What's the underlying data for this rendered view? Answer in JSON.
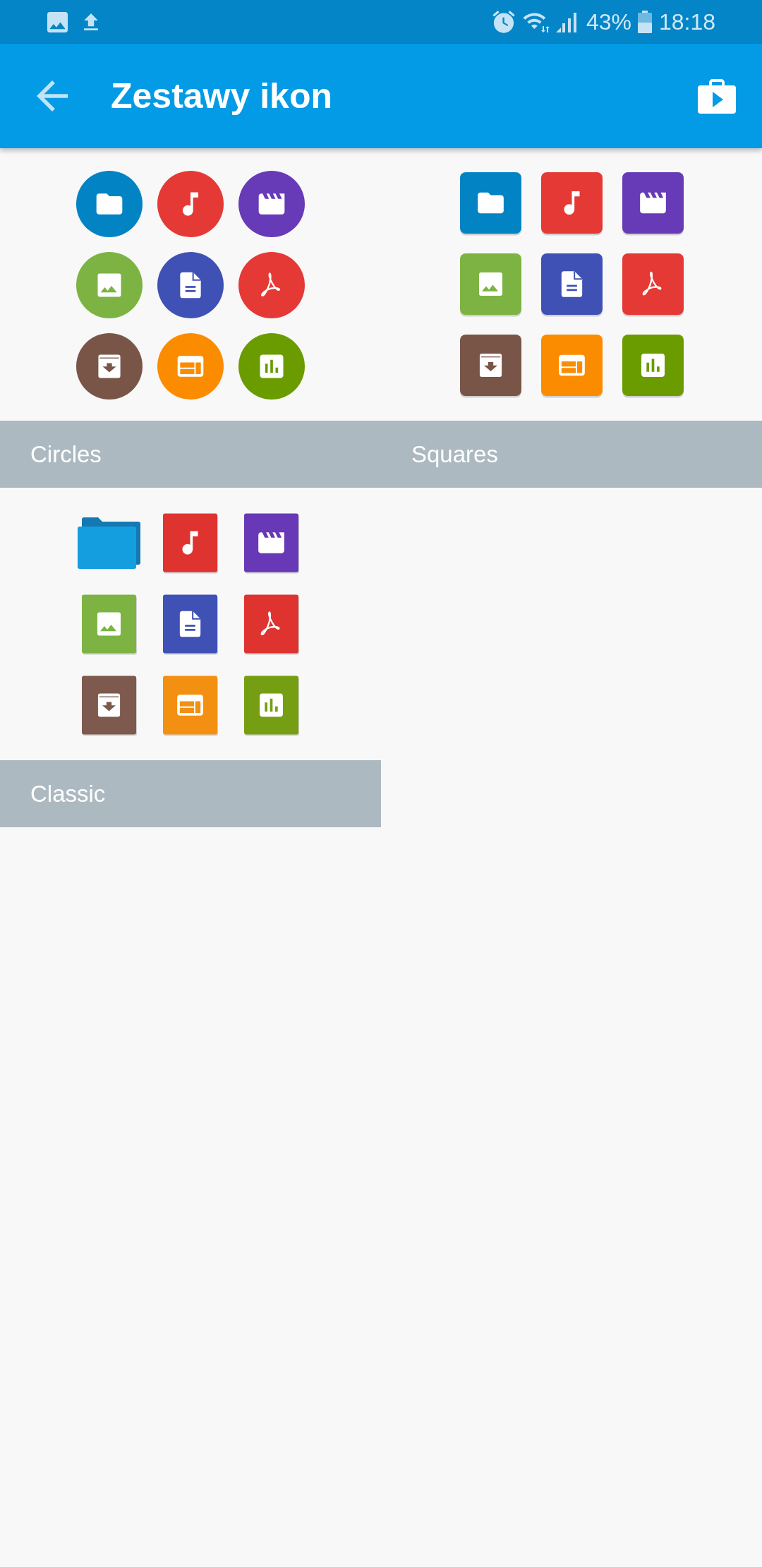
{
  "status_bar": {
    "battery": "43%",
    "time": "18:18"
  },
  "app_bar": {
    "title": "Zestawy ikon"
  },
  "icon_sets": [
    {
      "label": "Circles",
      "kind": "circles"
    },
    {
      "label": "Squares",
      "kind": "squares"
    },
    {
      "label": "Classic",
      "kind": "classic"
    }
  ]
}
